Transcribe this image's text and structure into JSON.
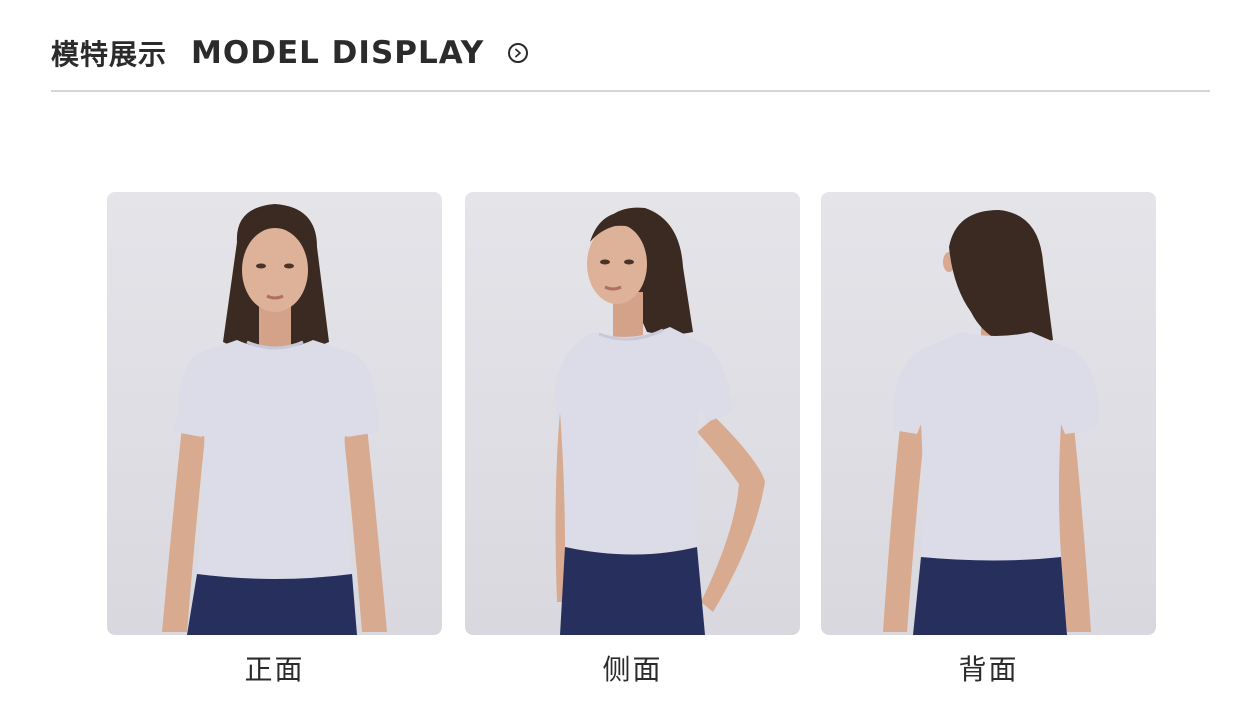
{
  "header": {
    "title_cn": "模特展示",
    "title_en": "MODEL DISPLAY",
    "arrow_icon": "circle-chevron-right-icon"
  },
  "views": [
    {
      "label": "正面"
    },
    {
      "label": "侧面"
    },
    {
      "label": "背面"
    }
  ],
  "colors": {
    "text": "#2b2b2b",
    "divider": "#d6d6d6",
    "photo_background": "#e2e2e7",
    "shirt": "#dcdbe8",
    "leggings": "#27305d",
    "hair": "#3a2a22",
    "skin": "#d9ab92"
  }
}
